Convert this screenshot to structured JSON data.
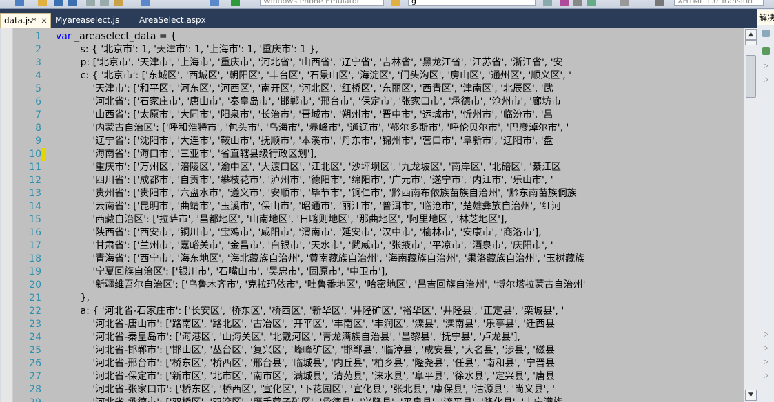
{
  "toolbar": {
    "target_device": "Windows Phone Emulator",
    "search_value": "g",
    "language": "XHTML 1.0 Transitio"
  },
  "tabs": [
    {
      "label": "data.js*",
      "active": true,
      "close": "×"
    },
    {
      "label": "Myareaselect.js",
      "active": false
    },
    {
      "label": "AreaSelect.aspx",
      "active": false
    }
  ],
  "right_panel": {
    "title": "解决"
  },
  "scrollbar": {
    "up": "▲",
    "down": "▼"
  },
  "code_lines": [
    {
      "n": "1",
      "kw": "var",
      "text": " _areaselect_data = {"
    },
    {
      "n": "2",
      "text": "        s: { '北京市': 1, '天津市': 1, '上海市': 1, '重庆市': 1 },"
    },
    {
      "n": "3",
      "text": "        p: ['北京市', '天津市', '上海市', '重庆市', '河北省', '山西省', '辽宁省', '吉林省', '黑龙江省', '江苏省', '浙江省', '安"
    },
    {
      "n": "4",
      "text": "        c: { '北京市': ['东城区', '西城区', '朝阳区', '丰台区', '石景山区', '海淀区', '门头沟区', '房山区', '通州区', '顺义区', '"
    },
    {
      "n": "5",
      "text": "            '天津市': ['和平区', '河东区', '河西区', '南开区', '河北区', '红桥区', '东丽区', '西青区', '津南区', '北辰区', '武"
    },
    {
      "n": "6",
      "text": "            '河北省': ['石家庄市', '唐山市', '秦皇岛市', '邯郸市', '邢台市', '保定市', '张家口市', '承德市', '沧州市', '廊坊市"
    },
    {
      "n": "7",
      "text": "            '山西省': ['太原市', '大同市', '阳泉市', '长治市', '晋城市', '朔州市', '晋中市', '运城市', '忻州市', '临汾市', '吕"
    },
    {
      "n": "8",
      "text": "            '内蒙古自治区': ['呼和浩特市', '包头市', '乌海市', '赤峰市', '通辽市', '鄂尔多斯市', '呼伦贝尔市', '巴彦淖尔市', '"
    },
    {
      "n": "9",
      "text": "            '辽宁省': ['沈阳市', '大连市', '鞍山市', '抚顺市', '本溪市', '丹东市', '锦州市', '营口市', '阜新市', '辽阳市', '盘"
    },
    {
      "n": "10",
      "text": "            '海南省': ['海口市', '三亚市', '省直辖县级行政区划'],",
      "mark": true,
      "caret": true
    },
    {
      "n": "11",
      "text": "            '重庆市': ['万州区', '涪陵区', '渝中区', '大渡口区', '江北区', '沙坪坝区', '九龙坡区', '南岸区', '北碚区', '綦江区"
    },
    {
      "n": "12",
      "text": "            '四川省': ['成都市', '自贡市', '攀枝花市', '泸州市', '德阳市', '绵阳市', '广元市', '遂宁市', '内江市', '乐山市', '"
    },
    {
      "n": "13",
      "text": "            '贵州省': ['贵阳市', '六盘水市', '遵义市', '安顺市', '毕节市', '铜仁市', '黔西南布依族苗族自治州', '黔东南苗族侗族"
    },
    {
      "n": "14",
      "text": "            '云南省': ['昆明市', '曲靖市', '玉溪市', '保山市', '昭通市', '丽江市', '普洱市', '临沧市', '楚雄彝族自治州', '红河"
    },
    {
      "n": "15",
      "text": "            '西藏自治区': ['拉萨市', '昌都地区', '山南地区', '日喀则地区', '那曲地区', '阿里地区', '林芝地区'],"
    },
    {
      "n": "16",
      "text": "            '陕西省': ['西安市', '铜川市', '宝鸡市', '咸阳市', '渭南市', '延安市', '汉中市', '榆林市', '安康市', '商洛市'],"
    },
    {
      "n": "17",
      "text": "            '甘肃省': ['兰州市', '嘉峪关市', '金昌市', '白银市', '天水市', '武威市', '张掖市', '平凉市', '酒泉市', '庆阳市', '"
    },
    {
      "n": "18",
      "text": "            '青海省': ['西宁市', '海东地区', '海北藏族自治州', '黄南藏族自治州', '海南藏族自治州', '果洛藏族自治州', '玉树藏族"
    },
    {
      "n": "19",
      "text": "            '宁夏回族自治区': ['银川市', '石嘴山市', '吴忠市', '固原市', '中卫市'],"
    },
    {
      "n": "20",
      "text": "            '新疆维吾尔自治区': ['乌鲁木齐市', '克拉玛依市', '吐鲁番地区', '哈密地区', '昌吉回族自治州', '博尔塔拉蒙古自治州'"
    },
    {
      "n": "21",
      "text": "        },"
    },
    {
      "n": "22",
      "text": "        a: { '河北省-石家庄市': ['长安区', '桥东区', '桥西区', '新华区', '井陉矿区', '裕华区', '井陉县', '正定县', '栾城县', '"
    },
    {
      "n": "23",
      "text": "            '河北省-唐山市': ['路南区', '路北区', '古冶区', '开平区', '丰南区', '丰润区', '滦县', '滦南县', '乐亭县', '迁西县"
    },
    {
      "n": "24",
      "text": "            '河北省-秦皇岛市': ['海港区', '山海关区', '北戴河区', '青龙满族自治县', '昌黎县', '抚宁县', '卢龙县'],"
    },
    {
      "n": "25",
      "text": "            '河北省-邯郸市': ['邯山区', '丛台区', '复兴区', '峰峰矿区', '邯郸县', '临漳县', '成安县', '大名县', '涉县', '磁县"
    },
    {
      "n": "26",
      "text": "            '河北省-邢台市': ['桥东区', '桥西区', '邢台县', '临城县', '内丘县', '柏乡县', '隆尧县', '任县', '南和县', '宁晋县"
    },
    {
      "n": "27",
      "text": "            '河北省-保定市': ['新市区', '北市区', '南市区', '满城县', '清苑县', '涞水县', '阜平县', '徐水县', '定兴县', '唐县"
    },
    {
      "n": "28",
      "text": "            '河北省-张家口市': ['桥东区', '桥西区', '宣化区', '下花园区', '宣化县', '张北县', '康保县', '沽源县', '尚义县', '"
    },
    {
      "n": "29",
      "text": "            '河北省-承德市': ['双桥区', '双滦区', '鹰手营子矿区', '承德县', '兴隆县', '平泉县', '滦平县', '隆化县', '丰宁满族"
    }
  ]
}
